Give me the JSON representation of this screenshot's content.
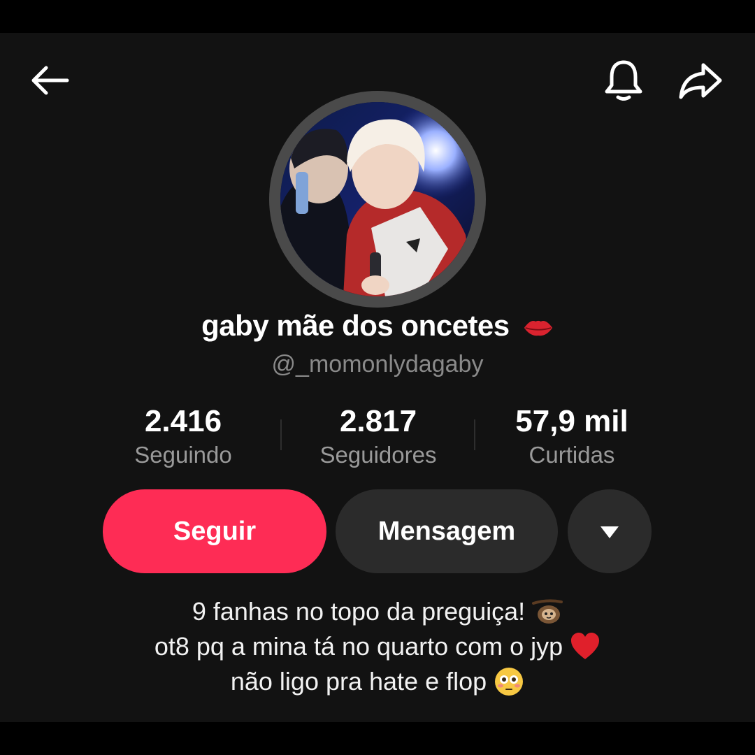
{
  "profile": {
    "display_name": "gaby mãe dos oncetes",
    "name_emoji_icon": "lips-emoji-icon",
    "handle": "@_momonlydagaby"
  },
  "stats": {
    "following": {
      "value": "2.416",
      "label": "Seguindo"
    },
    "followers": {
      "value": "2.817",
      "label": "Seguidores"
    },
    "likes": {
      "value": "57,9 mil",
      "label": "Curtidas"
    }
  },
  "actions": {
    "follow_label": "Seguir",
    "message_label": "Mensagem",
    "more_icon": "triangle-down-icon"
  },
  "bio": {
    "line1": "9 fanhas no topo da preguiça!",
    "line1_emoji": "sloth-emoji-icon",
    "line2": "ot8 pq a mina tá no quarto com o jyp",
    "line2_emoji": "red-heart-emoji-icon",
    "line3": "não ligo pra hate e flop",
    "line3_emoji": "flushed-face-emoji-icon"
  },
  "topbar": {
    "back_icon": "arrow-left-icon",
    "bell_icon": "bell-icon",
    "share_icon": "share-arrow-icon"
  },
  "colors": {
    "background": "#121212",
    "follow_button": "#fe2c55",
    "secondary_button": "#2b2b2b",
    "muted_text": "#8a8a8a"
  }
}
